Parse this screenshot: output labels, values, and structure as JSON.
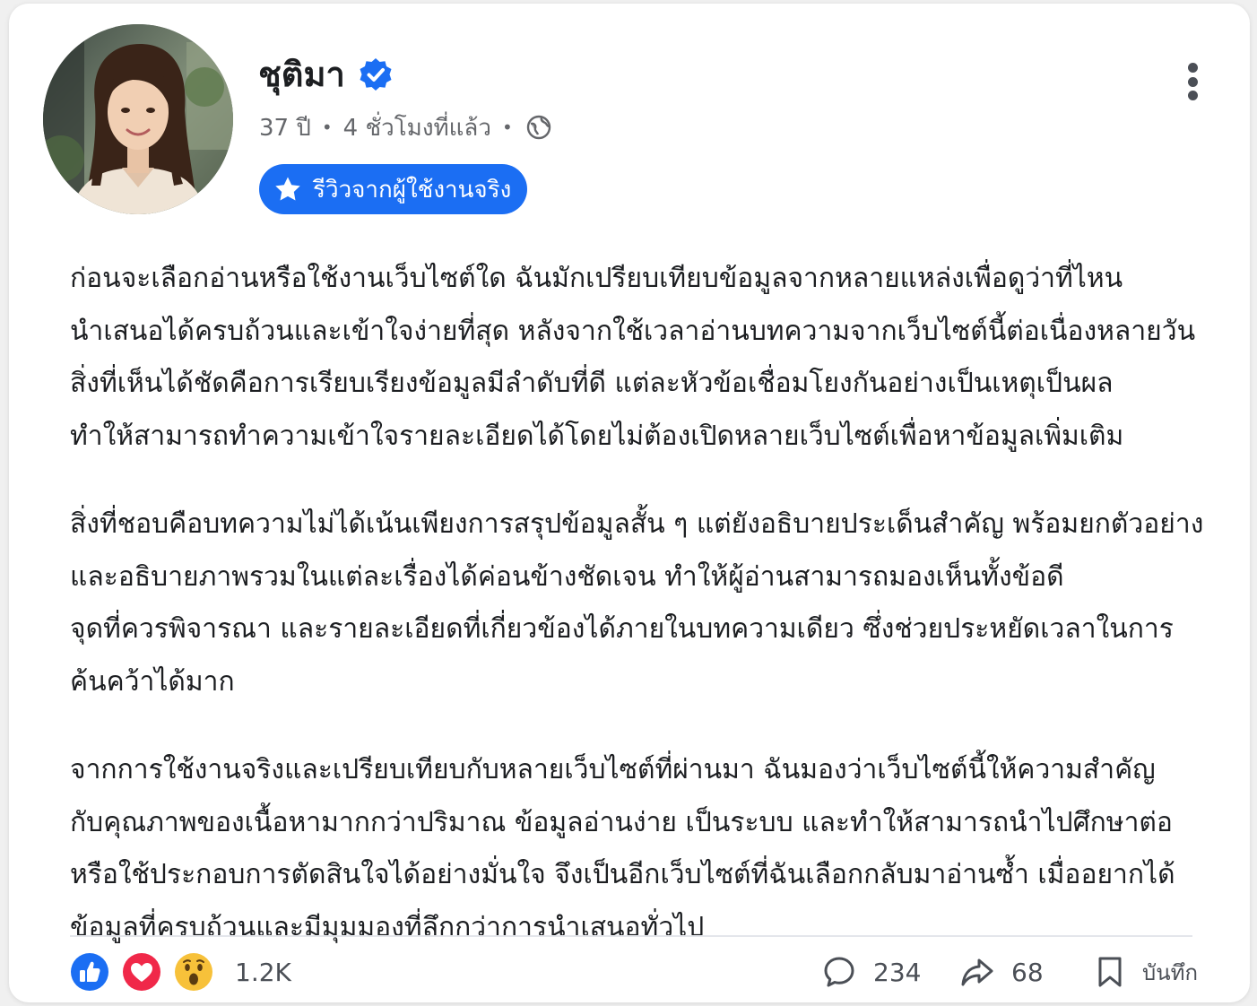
{
  "post": {
    "author": {
      "name": "ชุติมา",
      "verified": true,
      "age": "37 ปี",
      "time": "4 ชั่วโมงที่แล้ว",
      "privacy_icon": "globe-icon"
    },
    "badge": {
      "icon": "star-icon",
      "label": "รีวิวจากผู้ใช้งานจริง"
    },
    "menu_icon": "more-vertical-icon",
    "paragraphs": [
      {
        "lines": [
          "ก่อนจะเลือกอ่านหรือใช้งานเว็บไซต์ใด ฉันมักเปรียบเทียบข้อมูลจากหลายแหล่งเพื่อดูว่าที่ไหน",
          "นำเสนอได้ครบถ้วนและเข้าใจง่ายที่สุด หลังจากใช้เวลาอ่านบทความจากเว็บไซต์นี้ต่อเนื่องหลายวัน",
          "สิ่งที่เห็นได้ชัดคือการเรียบเรียงข้อมูลมีลำดับที่ดี แต่ละหัวข้อเชื่อมโยงกันอย่างเป็นเหตุเป็นผล",
          "ทำให้สามารถทำความเข้าใจรายละเอียดได้โดยไม่ต้องเปิดหลายเว็บไซต์เพื่อหาข้อมูลเพิ่มเติม"
        ]
      },
      {
        "lines": [
          "สิ่งที่ชอบคือบทความไม่ได้เน้นเพียงการสรุปข้อมูลสั้น ๆ แต่ยังอธิบายประเด็นสำคัญ พร้อมยกตัวอย่าง",
          "และอธิบายภาพรวมในแต่ละเรื่องได้ค่อนข้างชัดเจน ทำให้ผู้อ่านสามารถมองเห็นทั้งข้อดี",
          "จุดที่ควรพิจารณา และรายละเอียดที่เกี่ยวข้องได้ภายในบทความเดียว ซึ่งช่วยประหยัดเวลาในการ",
          "ค้นคว้าได้มาก"
        ]
      },
      {
        "lines": [
          "จากการใช้งานจริงและเปรียบเทียบกับหลายเว็บไซต์ที่ผ่านมา ฉันมองว่าเว็บไซต์นี้ให้ความสำคัญ",
          "กับคุณภาพของเนื้อหามากกว่าปริมาณ ข้อมูลอ่านง่าย เป็นระบบ และทำให้สามารถนำไปศึกษาต่อ",
          "หรือใช้ประกอบการตัดสินใจได้อย่างมั่นใจ จึงเป็นอีกเว็บไซต์ที่ฉันเลือกกลับมาอ่านซ้ำ เมื่ออยากได้",
          "ข้อมูลที่ครบถ้วนและมีมุมมองที่ลึกกว่าการนำเสนอทั่วไป"
        ]
      }
    ],
    "footer": {
      "reactions": [
        "like-icon",
        "love-icon",
        "wow-icon"
      ],
      "reaction_count": "1.2K",
      "comments": {
        "icon": "comment-icon",
        "count": "234"
      },
      "shares": {
        "icon": "share-icon",
        "count": "68"
      },
      "save": {
        "icon": "bookmark-icon",
        "label": "บันทึก"
      }
    },
    "colors": {
      "accent": "#1b6ef3",
      "like": "#1b6ef3",
      "love": "#f02849",
      "wow": "#f7c13a",
      "meta_text": "#65676b"
    }
  }
}
